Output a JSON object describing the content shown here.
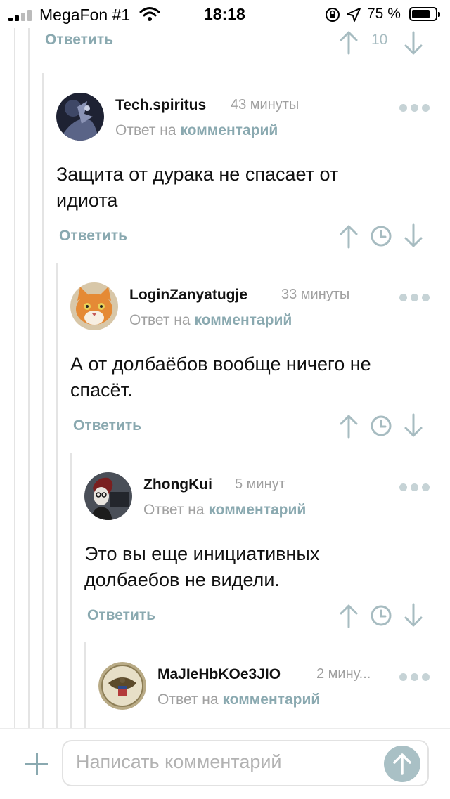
{
  "status_bar": {
    "carrier": "MegaFon #1",
    "time": "18:18",
    "battery": "75 %"
  },
  "top_actions": {
    "reply": "Ответить",
    "score": "10"
  },
  "comments": [
    {
      "username": "Tech.spiritus",
      "time": "43 минуты",
      "reply_prefix": "Ответ на",
      "reply_link": "комментарий",
      "text_lines": [
        "Защита от дурака не спасает от",
        "идиота"
      ],
      "reply": "Ответить"
    },
    {
      "username": "LoginZanyatugje",
      "time": "33 минуты",
      "reply_prefix": "Ответ на",
      "reply_link": "комментарий",
      "text_lines": [
        "А от долбаёбов вообще ничего не",
        "спасёт."
      ],
      "reply": "Ответить"
    },
    {
      "username": "ZhongKui",
      "time": "5 минут",
      "reply_prefix": "Ответ на",
      "reply_link": "комментарий",
      "text_lines": [
        "Это вы еще инициативных",
        "долбаебов не видели."
      ],
      "reply": "Ответить"
    },
    {
      "username": "MaJIeHbKOe3JIO",
      "time": "2 мину...",
      "reply_prefix": "Ответ на",
      "reply_link": "комментарий"
    }
  ],
  "composer": {
    "placeholder": "Написать комментарий"
  },
  "colors": {
    "accent": "#8aa9b0",
    "muted": "#a0a0a0",
    "thread_line": "#e4e4e4"
  }
}
